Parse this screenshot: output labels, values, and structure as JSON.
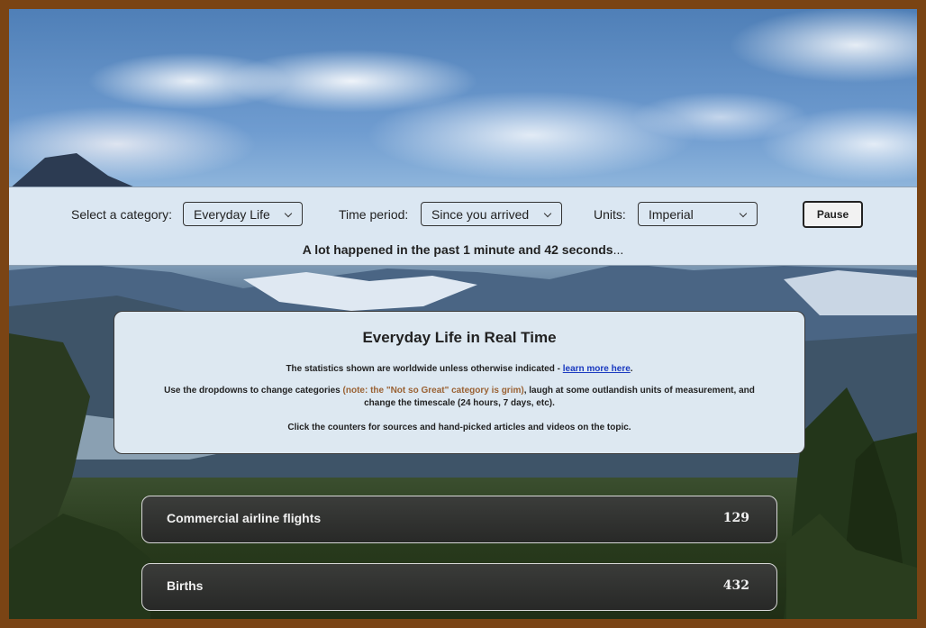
{
  "controls": {
    "category_label": "Select a category:",
    "category_value": "Everyday Life",
    "period_label": "Time period:",
    "period_value": "Since you arrived",
    "units_label": "Units:",
    "units_value": "Imperial",
    "pause_label": "Pause"
  },
  "summary": {
    "text": "A lot happened in the past 1 minute and 42 seconds",
    "ellipsis": "..."
  },
  "intro": {
    "title": "Everyday Life in Real Time",
    "line1": "The statistics shown are worldwide unless otherwise indicated - ",
    "learn_more": "learn more here",
    "line1_end": ".",
    "line2_start": "Use the dropdowns to change categories ",
    "line2_note": "(note: the \"Not so Great\" category is grim)",
    "line2_end": ", laugh at some outlandish units of measurement, and change the timescale (24 hours, 7 days, etc).",
    "line3": "Click the counters for sources and hand-picked articles and videos on the topic."
  },
  "counters": [
    {
      "label": "Commercial airline flights",
      "value": "129"
    },
    {
      "label": "Births",
      "value": "432"
    }
  ],
  "colors": {
    "frame": "#7a4414",
    "panel": "#dbe7f2",
    "note": "#9a6234",
    "link": "#1a3ac0"
  }
}
